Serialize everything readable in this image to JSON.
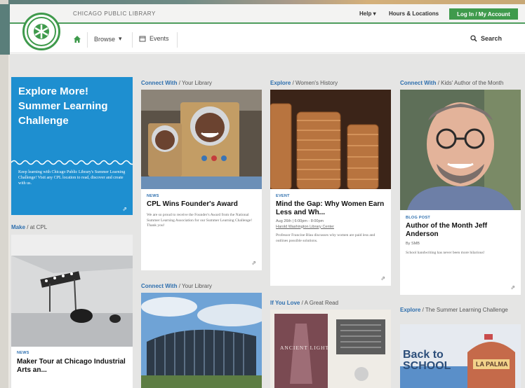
{
  "header": {
    "brand": "CHICAGO PUBLIC LIBRARY",
    "help": "Help",
    "hours": "Hours & Locations",
    "login": "Log In / My Account"
  },
  "nav": {
    "browse": "Browse",
    "events": "Events",
    "search": "Search"
  },
  "promo": {
    "title": "Explore More! Summer Learning Challenge",
    "body": "Keep learning with Chicago Public Library's Summer Learning Challenge! Visit any CPL location to read, discover and create with us."
  },
  "sections": {
    "make": {
      "hl": "Make",
      "rest": "at CPL"
    },
    "connect1": {
      "hl": "Connect With",
      "rest": "Your Library"
    },
    "connect2": {
      "hl": "Connect With",
      "rest": "Your Library"
    },
    "explore1": {
      "hl": "Explore",
      "rest": "Women's History"
    },
    "ifyoulove": {
      "hl": "If You Love",
      "rest": "A Great Read"
    },
    "connect3": {
      "hl": "Connect With",
      "rest": "Kids' Author of the Month"
    },
    "explore2": {
      "hl": "Explore",
      "rest": "The Summer Learning Challenge"
    }
  },
  "cards": {
    "founders": {
      "tag": "NEWS",
      "title": "CPL Wins Founder's Award",
      "body": "We are so proud to receive the Founder's Award from the National Summer Learning Association for our Summer Learning Challenge! Thank you!"
    },
    "mindgap": {
      "tag": "EVENT",
      "title": "Mind the Gap: Why Women Earn Less and Wh...",
      "date": "Aug 26th | 6:00pm - 8:00pm",
      "location": "Harold Washington Library Center",
      "body": "Professor Francine Blau discusses why women are paid less and outlines possible solutions."
    },
    "author": {
      "tag": "BLOG POST",
      "title": "Author of the Month Jeff Anderson",
      "byline": "By SMB",
      "body": "School handwriting has never been more hilarious!"
    },
    "maker": {
      "tag": "NEWS",
      "title": "Maker Tour at Chicago Industrial Arts an..."
    },
    "bookcover": {
      "text": "ANCIENT LIGHT"
    },
    "backtoschool": {
      "text": "Back to SCHOOL",
      "sign": "LA PALMA"
    }
  },
  "colors": {
    "green": "#3f9a4c",
    "blue": "#1e8fd0",
    "link": "#2e6fae"
  }
}
